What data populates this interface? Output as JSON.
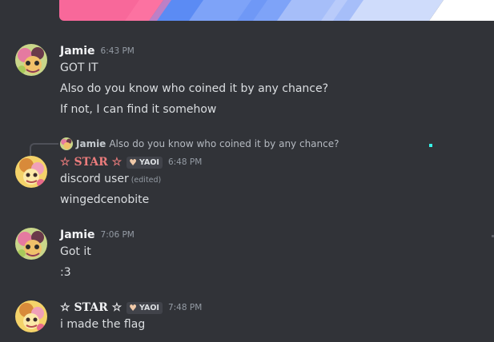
{
  "flag": {
    "name": "flag-image",
    "colors": [
      "#f8689a",
      "#5b8bf4",
      "#7ea3f8",
      "#a6bef9",
      "#cfdcfb",
      "#ffffff"
    ]
  },
  "messages": [
    {
      "author": "Jamie",
      "timestamp": "6:43 PM",
      "lines": [
        "GOT IT",
        "Also do you know who coined it by any chance?",
        "If not, I can find it somehow"
      ]
    },
    {
      "reply": {
        "author": "Jamie",
        "text": "Also do you know who coined it by any chance?"
      },
      "author_prefix": "☆",
      "author": "STAR",
      "author_suffix": "☆",
      "role_tag": "YAOI",
      "role_icon": "heart-icon",
      "timestamp": "6:48 PM",
      "lines": [
        "discord user",
        "wingedcenobite"
      ],
      "edited_label": "(edited)"
    },
    {
      "author": "Jamie",
      "timestamp": "7:06 PM",
      "lines": [
        "Got it",
        ":3"
      ]
    },
    {
      "author_prefix": "☆",
      "author": "STAR",
      "author_suffix": "☆",
      "role_tag": "YAOI",
      "role_icon": "heart-icon",
      "timestamp": "7:48 PM",
      "lines": [
        "i made the flag"
      ]
    }
  ],
  "colors": {
    "background": "#313338",
    "star_name": "#eb7c7c",
    "text": "#dbdee1",
    "muted": "#949ba4",
    "accent_dot": "#37f3e8"
  }
}
